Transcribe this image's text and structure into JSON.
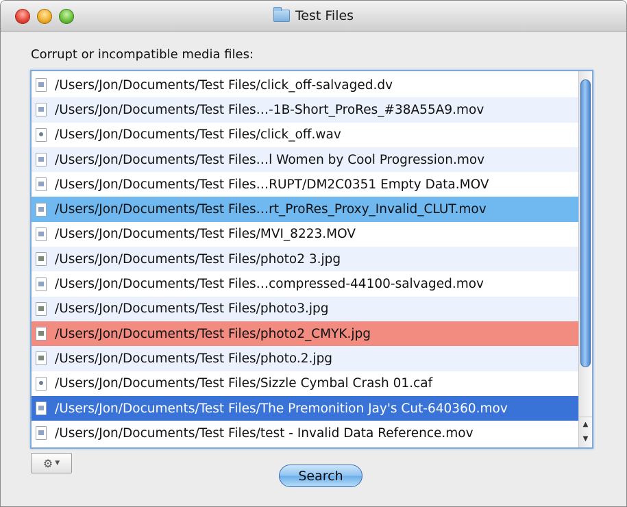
{
  "window": {
    "title": "Test Files"
  },
  "heading": "Corrupt or incompatible media files:",
  "files": [
    {
      "path": "/Users/Jon/Documents/Test Files/click_off-salvaged.dv",
      "icon": "video-file-icon",
      "state": "normal"
    },
    {
      "path": "/Users/Jon/Documents/Test Files…-1B-Short_ProRes_#38A55A9.mov",
      "icon": "video-file-icon",
      "state": "normal"
    },
    {
      "path": "/Users/Jon/Documents/Test Files/click_off.wav",
      "icon": "audio-file-icon",
      "state": "normal"
    },
    {
      "path": "/Users/Jon/Documents/Test Files…l Women by Cool Progression.mov",
      "icon": "video-file-icon",
      "state": "normal"
    },
    {
      "path": "/Users/Jon/Documents/Test Files…RUPT/DM2C0351 Empty Data.MOV",
      "icon": "video-file-icon",
      "state": "normal"
    },
    {
      "path": "/Users/Jon/Documents/Test Files…rt_ProRes_Proxy_Invalid_CLUT.mov",
      "icon": "video-file-icon",
      "state": "highlight-blue"
    },
    {
      "path": "/Users/Jon/Documents/Test Files/MVI_8223.MOV",
      "icon": "video-file-icon",
      "state": "normal"
    },
    {
      "path": "/Users/Jon/Documents/Test Files/photo2 3.jpg",
      "icon": "image-file-icon",
      "state": "normal"
    },
    {
      "path": "/Users/Jon/Documents/Test Files…compressed-44100-salvaged.mov",
      "icon": "video-file-icon",
      "state": "normal"
    },
    {
      "path": "/Users/Jon/Documents/Test Files/photo3.jpg",
      "icon": "image-file-icon",
      "state": "normal"
    },
    {
      "path": "/Users/Jon/Documents/Test Files/photo2_CMYK.jpg",
      "icon": "image-file-icon",
      "state": "highlight-red"
    },
    {
      "path": "/Users/Jon/Documents/Test Files/photo.2.jpg",
      "icon": "image-file-icon",
      "state": "normal"
    },
    {
      "path": "/Users/Jon/Documents/Test Files/Sizzle Cymbal Crash 01.caf",
      "icon": "audio-file-icon",
      "state": "normal"
    },
    {
      "path": "/Users/Jon/Documents/Test Files/The Premonition Jay's Cut-640360.mov",
      "icon": "video-file-icon",
      "state": "selected"
    },
    {
      "path": "/Users/Jon/Documents/Test Files/test - Invalid Data Reference.mov",
      "icon": "video-file-icon",
      "state": "normal"
    }
  ],
  "buttons": {
    "search": "Search",
    "action_menu_icon": "gear-icon"
  },
  "colors": {
    "highlight_blue": "#6fb8f0",
    "highlight_red": "#f28b80",
    "selected": "#3a73d8",
    "alt_row": "#ecf2fd"
  }
}
